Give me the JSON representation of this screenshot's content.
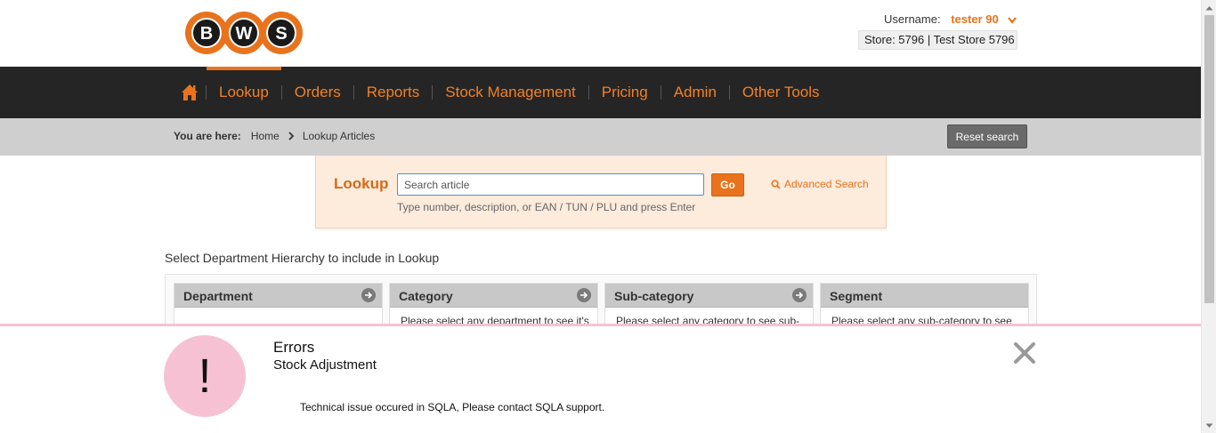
{
  "brand": {
    "logo_letters": [
      "B",
      "W",
      "S"
    ],
    "colors": {
      "orange": "#e8731c",
      "dark": "#252525",
      "pink": "#f7c1d4"
    }
  },
  "user": {
    "label": "Username:",
    "name": "tester 90",
    "store": "Store: 5796 | Test Store 5796"
  },
  "nav": {
    "home_icon": "home-icon",
    "items": [
      {
        "label": "Lookup",
        "active": true
      },
      {
        "label": "Orders"
      },
      {
        "label": "Reports"
      },
      {
        "label": "Stock Management"
      },
      {
        "label": "Pricing"
      },
      {
        "label": "Admin"
      },
      {
        "label": "Other Tools"
      }
    ]
  },
  "breadcrumb": {
    "label": "You are here:",
    "items": [
      "Home",
      "Lookup Articles"
    ],
    "reset_label": "Reset search"
  },
  "lookup": {
    "title": "Lookup",
    "placeholder": "Search article",
    "value": "",
    "go_label": "Go",
    "advanced_label": "Advanced Search",
    "hint": "Type number, description, or EAN / TUN / PLU and press Enter"
  },
  "hierarchy": {
    "title": "Select Department Hierarchy to include in Lookup",
    "columns": [
      {
        "title": "Department",
        "body": ""
      },
      {
        "title": "Category",
        "body": "Please select any department to see it's"
      },
      {
        "title": "Sub-category",
        "body": "Please select any category to see sub-"
      },
      {
        "title": "Segment",
        "body": "Please select any sub-category to see"
      }
    ]
  },
  "error": {
    "symbol": "!",
    "title": "Errors",
    "subtitle": "Stock Adjustment",
    "message": "Technical issue occured in SQLA, Please contact SQLA support."
  }
}
